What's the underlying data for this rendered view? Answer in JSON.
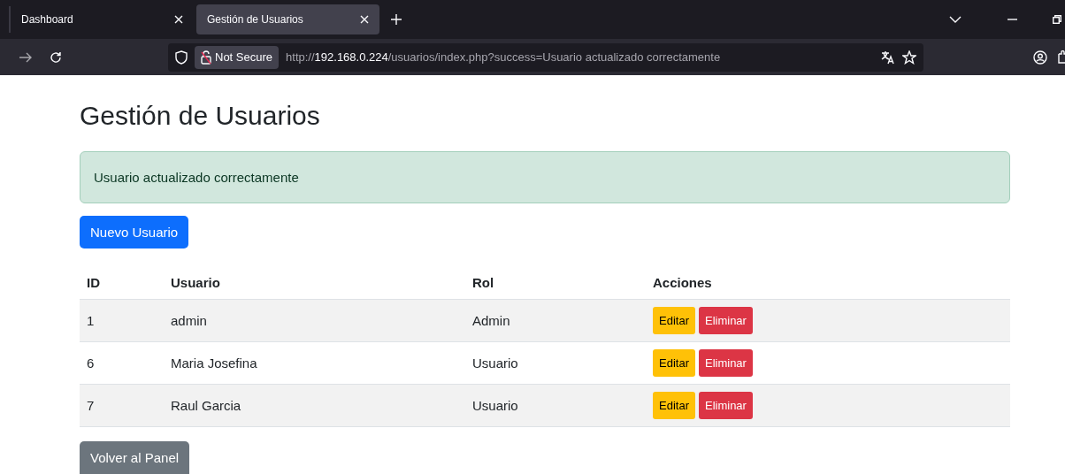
{
  "browser": {
    "tabs": [
      {
        "title": "Dashboard",
        "selected": false
      },
      {
        "title": "Gestión de Usuarios",
        "selected": true
      }
    ],
    "security_label": "Not Secure",
    "url": {
      "scheme": "http://",
      "host": "192.168.0.224",
      "path": "/usuarios/index.php?success=Usuario actualizado correctamente"
    }
  },
  "page": {
    "title": "Gestión de Usuarios",
    "alert": "Usuario actualizado correctamente",
    "new_button": "Nuevo Usuario",
    "table": {
      "columns": [
        "ID",
        "Usuario",
        "Rol",
        "Acciones"
      ],
      "rows": [
        {
          "id": "1",
          "user": "admin",
          "role": "Admin",
          "actions": [
            "Editar",
            "Eliminar"
          ]
        },
        {
          "id": "6",
          "user": "Maria Josefina",
          "role": "Usuario",
          "actions": [
            "Editar",
            "Eliminar"
          ]
        },
        {
          "id": "7",
          "user": "Raul Garcia",
          "role": "Usuario",
          "actions": [
            "Editar",
            "Eliminar"
          ]
        }
      ]
    },
    "back_button": "Volver al Panel"
  }
}
